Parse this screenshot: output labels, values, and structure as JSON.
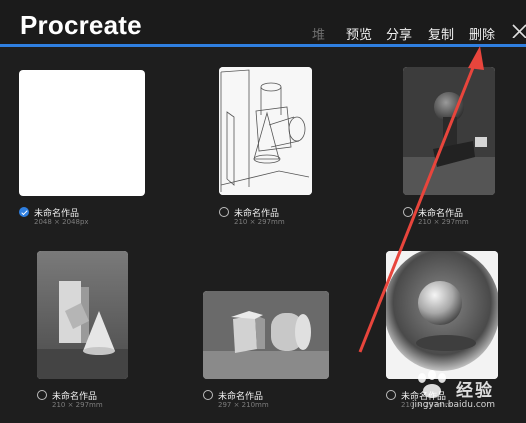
{
  "app": {
    "title": "Procreate"
  },
  "toolbar": {
    "stack_label": "堆",
    "preview_label": "预览",
    "share_label": "分享",
    "duplicate_label": "复制",
    "delete_label": "删除"
  },
  "gallery": {
    "items": [
      {
        "name": "未命名作品",
        "size": "2048 × 2048px",
        "selected": true
      },
      {
        "name": "未命名作品",
        "size": "210 × 297mm",
        "selected": false
      },
      {
        "name": "未命名作品",
        "size": "210 × 297mm",
        "selected": false
      },
      {
        "name": "未命名作品",
        "size": "210 × 297mm",
        "selected": false
      },
      {
        "name": "未命名作品",
        "size": "297 × 210mm",
        "selected": false
      },
      {
        "name": "未命名作品",
        "size": "210 × 297mm",
        "selected": false
      }
    ]
  },
  "colors": {
    "accent": "#2f7fe0",
    "annotation_arrow": "#e8453c"
  },
  "watermark": {
    "text": "经验",
    "url": "jingyan.baidu.com"
  }
}
